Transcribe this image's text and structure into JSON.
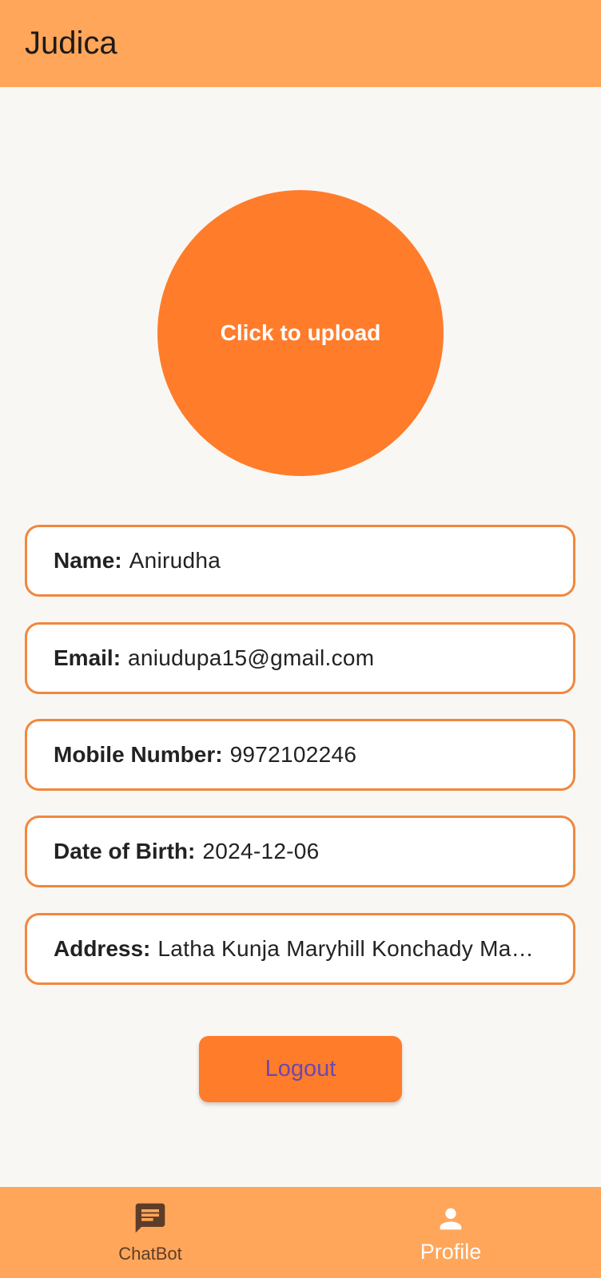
{
  "app_bar": {
    "title": "Judica"
  },
  "avatar": {
    "upload_label": "Click to upload"
  },
  "profile": {
    "fields": [
      {
        "label": "Name:",
        "value": "Anirudha"
      },
      {
        "label": "Email:",
        "value": "aniudupa15@gmail.com"
      },
      {
        "label": "Mobile Number:",
        "value": "9972102246"
      },
      {
        "label": "Date of Birth:",
        "value": "2024-12-06"
      },
      {
        "label": "Address:",
        "value": "Latha Kunja Maryhill Konchady Mangalore"
      }
    ]
  },
  "logout": {
    "label": "Logout"
  },
  "bottom_nav": {
    "items": [
      {
        "label": "ChatBot",
        "icon": "chat-icon",
        "selected": false
      },
      {
        "label": "Profile",
        "icon": "person-icon",
        "selected": true
      }
    ]
  },
  "colors": {
    "app_bar": "#ffa65a",
    "accent": "#ff7c2b",
    "card_border": "#f0873e",
    "background": "#f9f7f3",
    "logout_text": "#6a48b0"
  }
}
